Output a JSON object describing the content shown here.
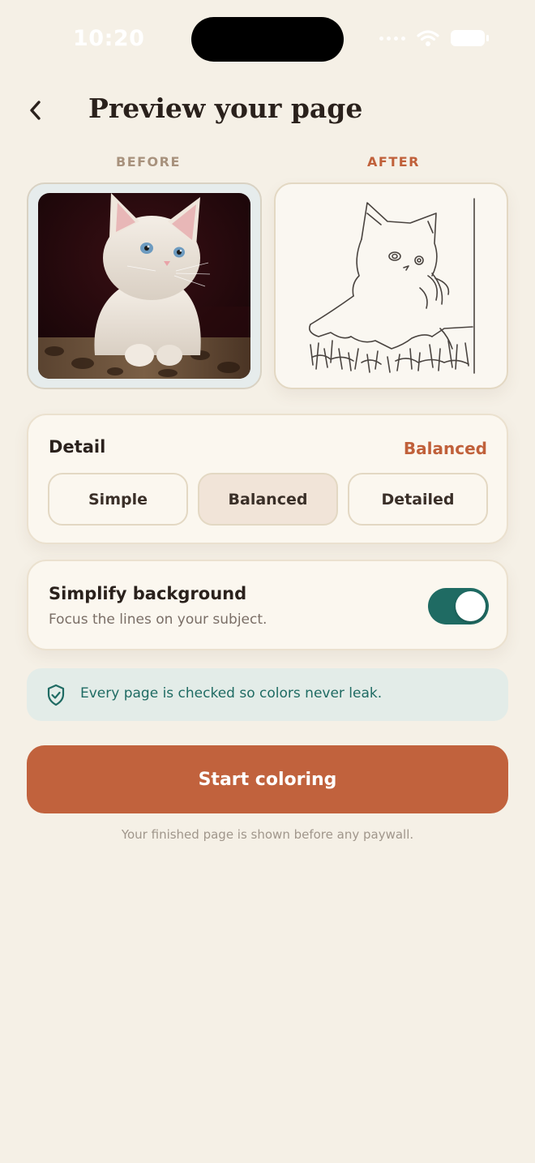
{
  "status_bar": {
    "time": "10:20"
  },
  "header": {
    "title": "Preview your page",
    "back_icon": "chevron-left-icon"
  },
  "preview": {
    "before_label": "BEFORE",
    "after_label": "AFTER"
  },
  "detail": {
    "title": "Detail",
    "selected_value": "Balanced",
    "options": [
      "Simple",
      "Balanced",
      "Detailed"
    ],
    "selected_index": 1
  },
  "simplify": {
    "title": "Simplify background",
    "subtitle": "Focus the lines on your subject.",
    "enabled": true
  },
  "notice": {
    "text": "Every page is checked so colors never leak.",
    "icon": "shield-check-icon"
  },
  "cta": {
    "label": "Start coloring"
  },
  "footnote": "Your finished page is shown before any paywall.",
  "colors": {
    "background": "#F5F0E6",
    "accent": "#C1623D",
    "teal": "#1F6B63",
    "text": "#2A211C"
  }
}
